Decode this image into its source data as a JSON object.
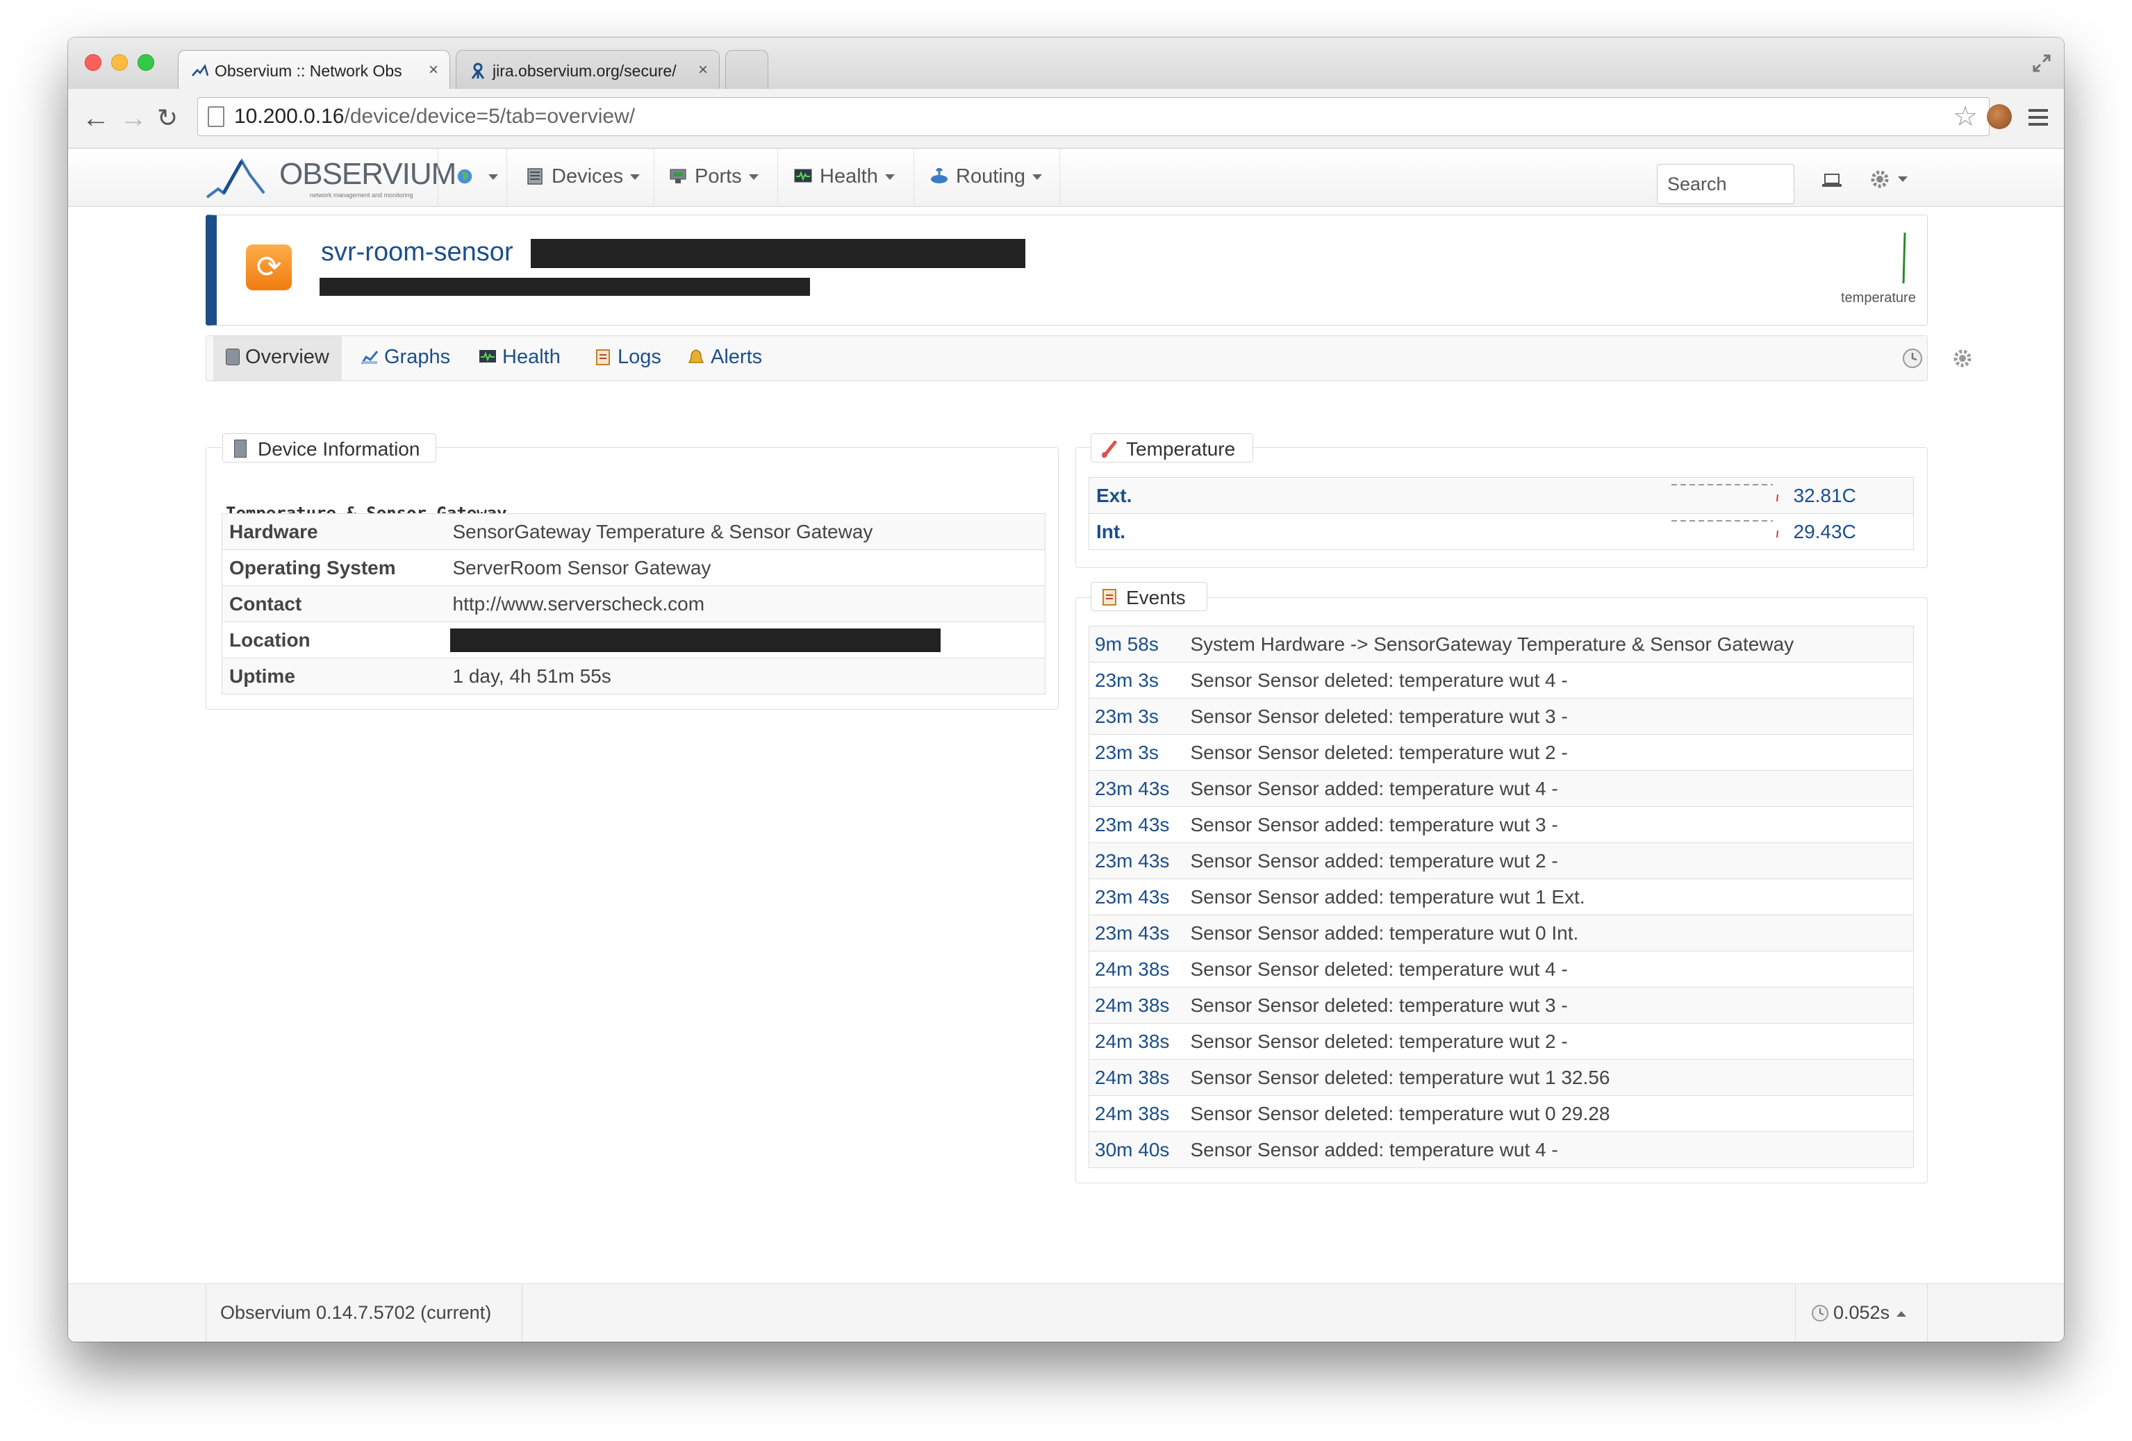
{
  "browser": {
    "tabs": [
      {
        "title": "Observium :: Network Obs",
        "active": true
      },
      {
        "title": "jira.observium.org/secure/",
        "active": false
      }
    ],
    "url_host": "10.200.0.16",
    "url_path": "/device/device=5/tab=overview/"
  },
  "navbar": {
    "logo": "OBSERVIUM",
    "logo_tagline": "network management and monitoring",
    "items": [
      {
        "label": "Devices"
      },
      {
        "label": "Ports"
      },
      {
        "label": "Health"
      },
      {
        "label": "Routing"
      }
    ],
    "search_placeholder": "Search"
  },
  "device": {
    "hostname": "svr-room-sensor",
    "sparkline_label": "temperature"
  },
  "device_tabs": [
    {
      "label": "Overview",
      "active": true
    },
    {
      "label": "Graphs"
    },
    {
      "label": "Health"
    },
    {
      "label": "Logs"
    },
    {
      "label": "Alerts"
    }
  ],
  "device_info": {
    "legend": "Device Information",
    "description": "Temperature & Sensor Gateway",
    "rows": [
      {
        "label": "Hardware",
        "value": "SensorGateway Temperature & Sensor Gateway"
      },
      {
        "label": "Operating System",
        "value": "ServerRoom Sensor Gateway"
      },
      {
        "label": "Contact",
        "value": "http://www.serverscheck.com"
      },
      {
        "label": "Location",
        "value": ""
      },
      {
        "label": "Uptime",
        "value": "1 day, 4h 51m 55s"
      }
    ]
  },
  "temperature": {
    "legend": "Temperature",
    "rows": [
      {
        "name": "Ext.",
        "value": "32.81C"
      },
      {
        "name": "Int.",
        "value": "29.43C"
      }
    ]
  },
  "events": {
    "legend": "Events",
    "rows": [
      {
        "time": "9m 58s",
        "message": "System Hardware -> SensorGateway Temperature & Sensor Gateway"
      },
      {
        "time": "23m 3s",
        "message": "Sensor Sensor deleted: temperature wut 4 -"
      },
      {
        "time": "23m 3s",
        "message": "Sensor Sensor deleted: temperature wut 3 -"
      },
      {
        "time": "23m 3s",
        "message": "Sensor Sensor deleted: temperature wut 2 -"
      },
      {
        "time": "23m 43s",
        "message": "Sensor Sensor added: temperature wut 4 -"
      },
      {
        "time": "23m 43s",
        "message": "Sensor Sensor added: temperature wut 3 -"
      },
      {
        "time": "23m 43s",
        "message": "Sensor Sensor added: temperature wut 2 -"
      },
      {
        "time": "23m 43s",
        "message": "Sensor Sensor added: temperature wut 1 Ext."
      },
      {
        "time": "23m 43s",
        "message": "Sensor Sensor added: temperature wut 0 Int."
      },
      {
        "time": "24m 38s",
        "message": "Sensor Sensor deleted: temperature wut 4 -"
      },
      {
        "time": "24m 38s",
        "message": "Sensor Sensor deleted: temperature wut 3 -"
      },
      {
        "time": "24m 38s",
        "message": "Sensor Sensor deleted: temperature wut 2 -"
      },
      {
        "time": "24m 38s",
        "message": "Sensor Sensor deleted: temperature wut 1 32.56"
      },
      {
        "time": "24m 38s",
        "message": "Sensor Sensor deleted: temperature wut 0 29.28"
      },
      {
        "time": "30m 40s",
        "message": "Sensor Sensor added: temperature wut 4 -"
      }
    ]
  },
  "footer": {
    "version": "Observium 0.14.7.5702 (current)",
    "runtime": "0.052s"
  }
}
